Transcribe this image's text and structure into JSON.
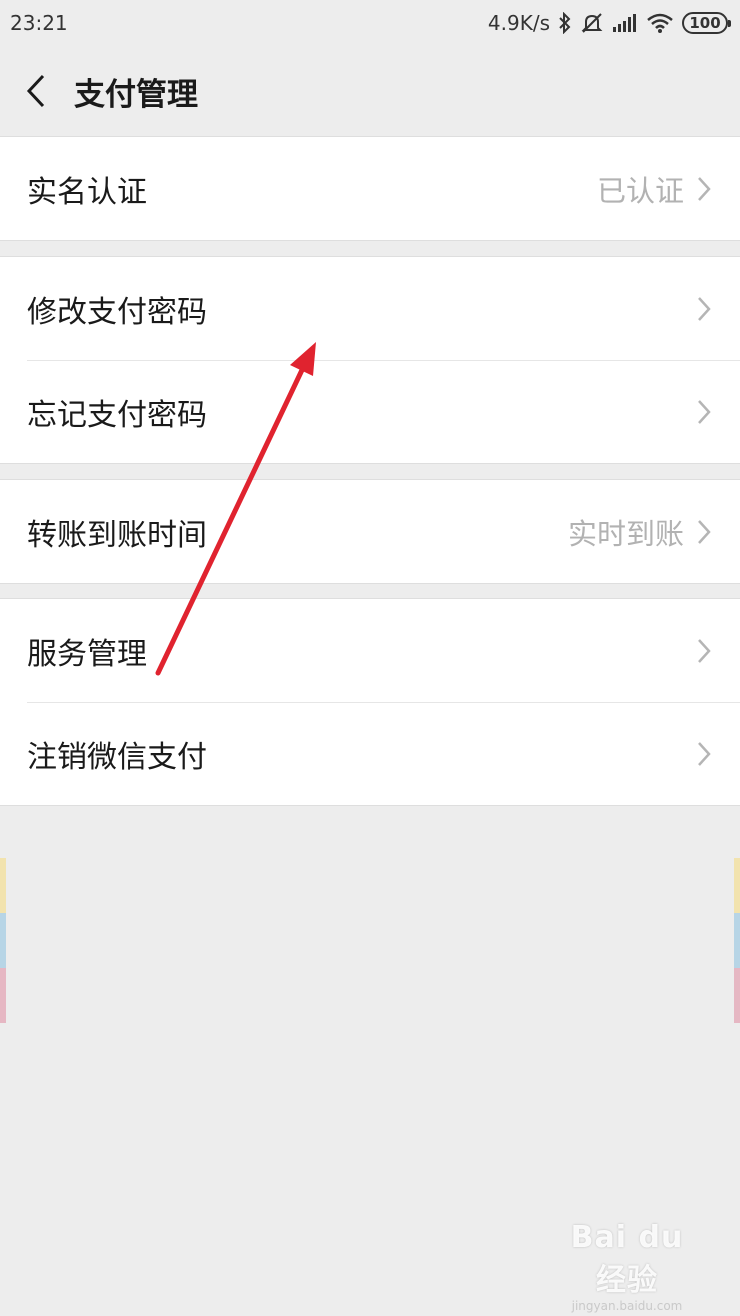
{
  "status_bar": {
    "time": "23:21",
    "network_speed": "4.9K/s",
    "battery": "100",
    "icons": [
      "bluetooth-icon",
      "mute-icon",
      "signal-icon",
      "wifi-icon",
      "battery-icon"
    ]
  },
  "header": {
    "title": "支付管理"
  },
  "groups": [
    {
      "rows": [
        {
          "label": "实名认证",
          "value": "已认证"
        }
      ]
    },
    {
      "rows": [
        {
          "label": "修改支付密码",
          "value": ""
        },
        {
          "label": "忘记支付密码",
          "value": ""
        }
      ]
    },
    {
      "rows": [
        {
          "label": "转账到账时间",
          "value": "实时到账"
        }
      ]
    },
    {
      "rows": [
        {
          "label": "服务管理",
          "value": ""
        },
        {
          "label": "注销微信支付",
          "value": ""
        }
      ]
    }
  ],
  "watermark": {
    "main": "Bai du 经验",
    "sub": "jingyan.baidu.com"
  },
  "colors": {
    "background": "#ededed",
    "card": "#ffffff",
    "secondary_text": "#b2b2b2",
    "annotation_arrow": "#e0232f"
  }
}
